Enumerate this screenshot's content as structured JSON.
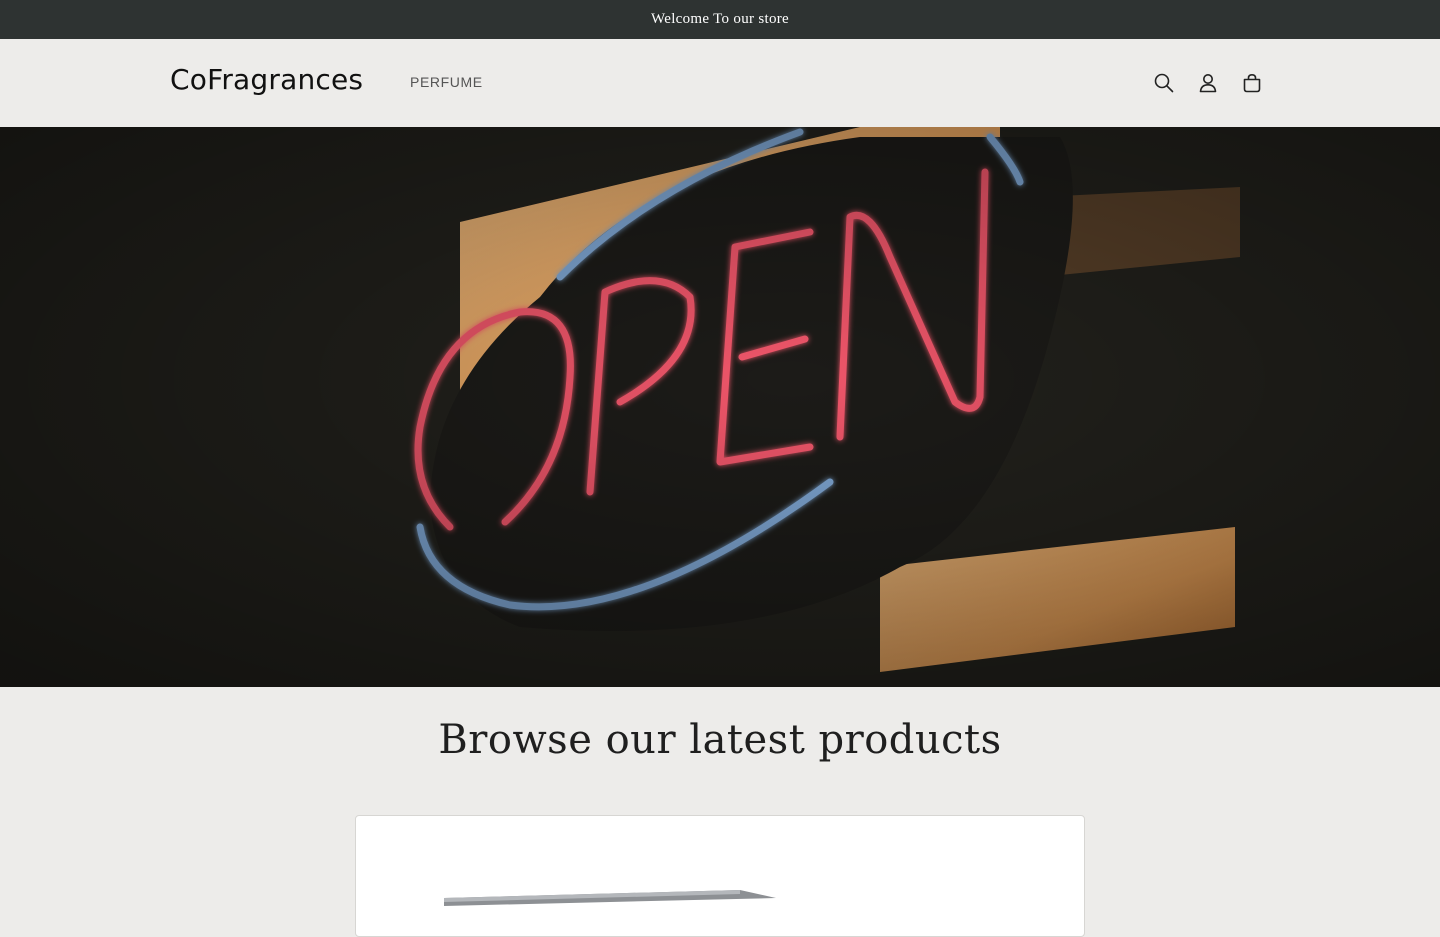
{
  "announcement": {
    "text": "Welcome To our store"
  },
  "header": {
    "logo": "CoFragrances",
    "nav": [
      {
        "label": "PERFUME"
      }
    ],
    "icons": [
      "search-icon",
      "account-icon",
      "cart-icon"
    ]
  },
  "hero": {
    "sign_text": "OPEN",
    "colors": {
      "neon_red": "#f0566b",
      "neon_blue": "#7fa7d4",
      "warm_light": "#f4b06a",
      "background": "#201f1b"
    }
  },
  "products_section": {
    "title": "Browse our latest products"
  },
  "theme": {
    "announcement_bg": "#2e3332",
    "page_bg": "#edecea"
  }
}
